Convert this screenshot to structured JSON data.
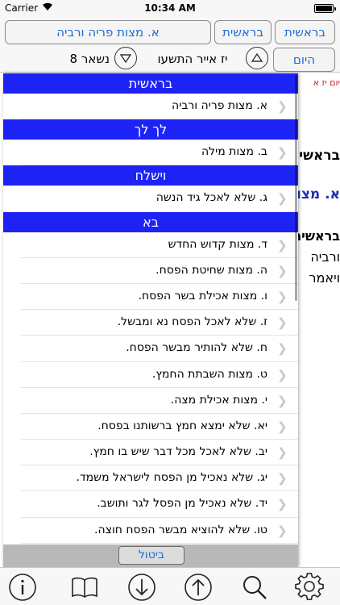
{
  "status_bar": {
    "carrier": "Carrier",
    "time": "10:34 AM"
  },
  "nav": {
    "book_button": "בראשית",
    "section_button": "בראשית",
    "title_button": "א. מצות פריה ורביה",
    "today_button": "היום",
    "date": "יז אייר התשעו",
    "remaining": "נשאר 8"
  },
  "background_text": {
    "line1": "יום יז א",
    "line2": "בראשית",
    "line3": "א. מצות",
    "line4": "בראשית",
    "line5": "ורביה",
    "line6": "ויאמר"
  },
  "list": {
    "sections": [
      {
        "header": "בראשית",
        "items": [
          "א. מצות פריה ורביה"
        ]
      },
      {
        "header": "לך לך",
        "items": [
          "ב. מצות מילה"
        ]
      },
      {
        "header": "וישלח",
        "items": [
          "ג. שלא לאכל גיד הנשה"
        ]
      },
      {
        "header": "בא",
        "items": [
          "ד. מצות קדוש החדש",
          "ה. מצות שחיטת הפסח.",
          "ו. מצות אכילת בשר הפסח.",
          "ז. שלא לאכל הפסח נא ומבשל.",
          "ח. שלא להותיר מבשר הפסח.",
          "ט. מצות השבתת החמץ.",
          "י. מצות אכילת מצה.",
          "יא. שלא ימצא חמץ ברשותנו בפסח.",
          "יב. שלא לאכל מכל דבר שיש בו חמץ.",
          "יג. שלא נאכיל מן הפסח לישראל משמד.",
          "יד. שלא נאכיל מן הפסל לגר ותושב.",
          "טו. שלא להוציא מבשר הפסח חוצה.",
          "טז. שלא לשבר עצם מן הפסח."
        ]
      }
    ],
    "cancel_button": "ביטול"
  },
  "toolbar": {
    "icons": [
      "info-icon",
      "book-icon",
      "arrow-down-icon",
      "arrow-up-icon",
      "search-icon",
      "gear-icon"
    ]
  },
  "colors": {
    "accent": "#1e6bd6",
    "section_header": "#1e23f5",
    "red_text": "#e01818",
    "blue_bold": "#1a2fb0"
  }
}
